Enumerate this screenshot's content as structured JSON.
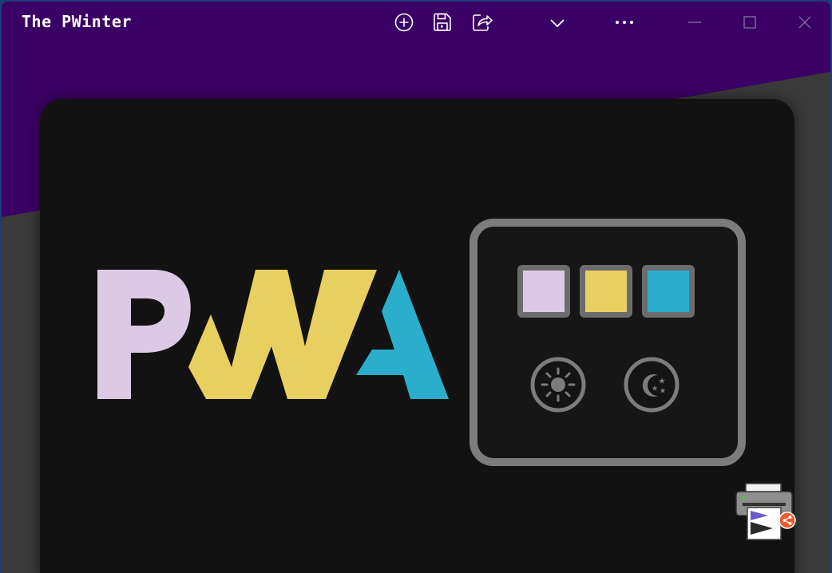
{
  "window": {
    "title": "The PWinter"
  },
  "toolbar": {
    "icons": [
      "add-circle-icon",
      "save-icon",
      "share-icon",
      "chevron-down-icon",
      "more-icon"
    ],
    "window_controls": [
      "minimize-icon",
      "maximize-icon",
      "close-icon"
    ]
  },
  "logo": {
    "letters": [
      "P",
      "W",
      "A"
    ],
    "colors": {
      "p": "#dccae5",
      "w": "#e8d060",
      "a": "#2aaecb"
    }
  },
  "palette": {
    "swatches": [
      {
        "name": "lavender",
        "color": "#dccae5"
      },
      {
        "name": "yellow",
        "color": "#e8d060"
      },
      {
        "name": "teal",
        "color": "#2aaecb"
      }
    ],
    "modes": [
      "light-mode-icon",
      "dark-mode-icon"
    ]
  },
  "colors": {
    "titlebar": "#3b0066",
    "card": "#121212",
    "panel_border": "#7c7c7c"
  }
}
